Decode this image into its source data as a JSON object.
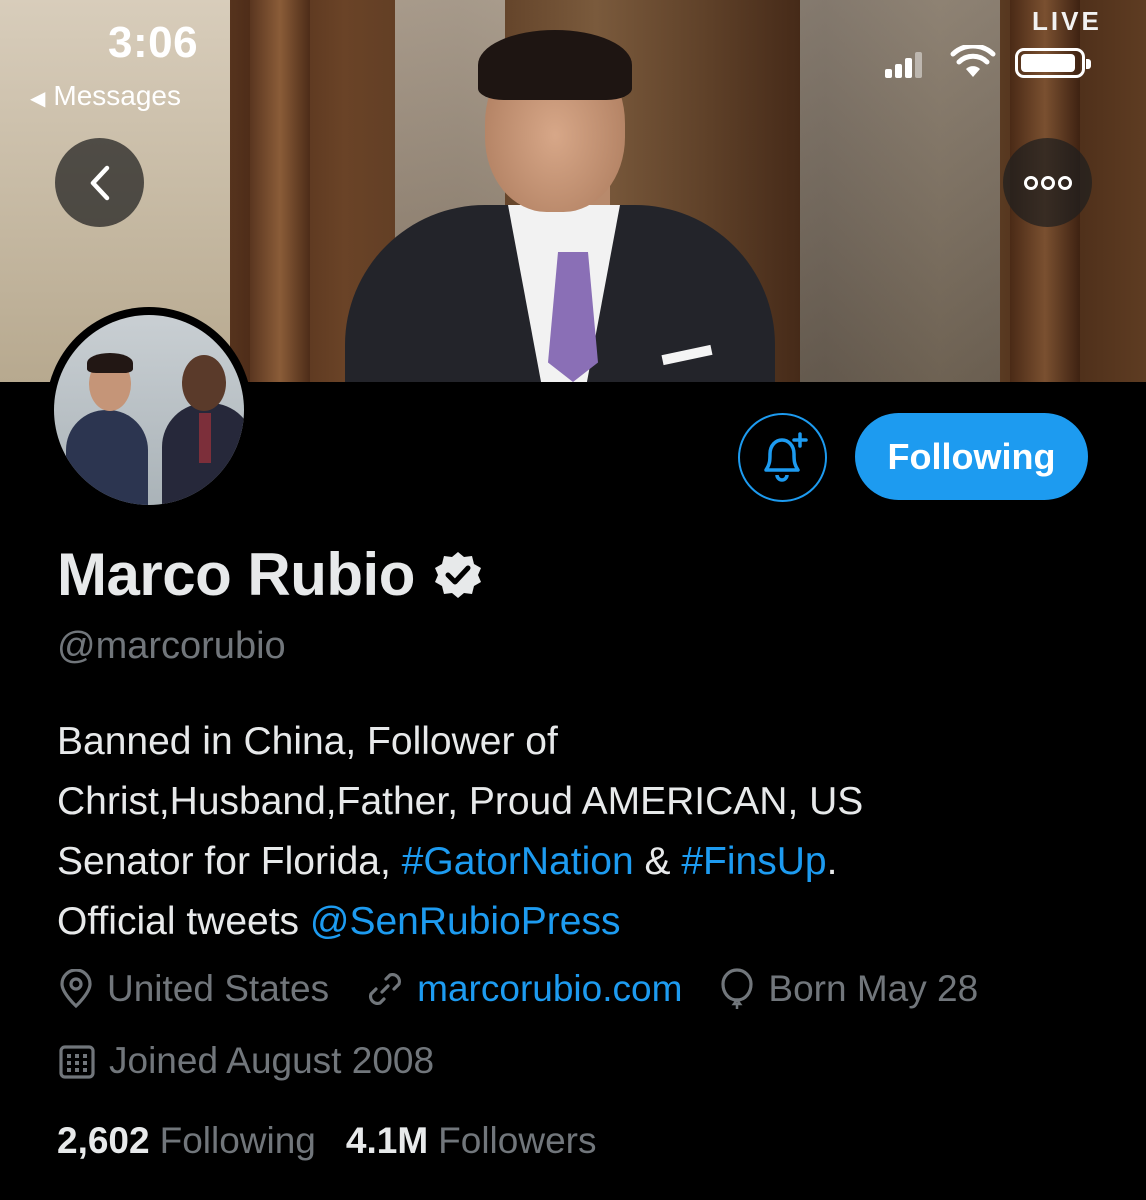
{
  "status_bar": {
    "time": "3:06",
    "back_label": "Messages",
    "live_badge": "LIVE"
  },
  "profile": {
    "name": "Marco Rubio",
    "handle": "@marcorubio",
    "verified": true,
    "follow_button_label": "Following",
    "bio": {
      "line1": "Banned in China, Follower of",
      "line2": "Christ,Husband,Father, Proud AMERICAN, US",
      "line3_prefix": "Senator for Florida, ",
      "hashtag1": "#GatorNation",
      "amp": " & ",
      "hashtag2": "#FinsUp",
      "line3_suffix": ".",
      "line4_prefix": "Official tweets ",
      "mention": "@SenRubioPress"
    },
    "location": "United States",
    "website": "marcorubio.com",
    "birthday": "Born May 28",
    "joined": "Joined August 2008",
    "following_count": "2,602",
    "following_label": "Following",
    "followers_count": "4.1M",
    "followers_label": "Followers"
  },
  "colors": {
    "accent": "#1d9bf0",
    "background": "#000000",
    "secondary_text": "#71767b",
    "primary_text": "#e7e9ea"
  },
  "icons": [
    "back-arrow-icon",
    "more-icon",
    "bell-plus-icon",
    "verified-badge-icon",
    "location-pin-icon",
    "link-icon",
    "balloon-icon",
    "calendar-icon",
    "signal-icon",
    "wifi-icon",
    "battery-icon"
  ]
}
